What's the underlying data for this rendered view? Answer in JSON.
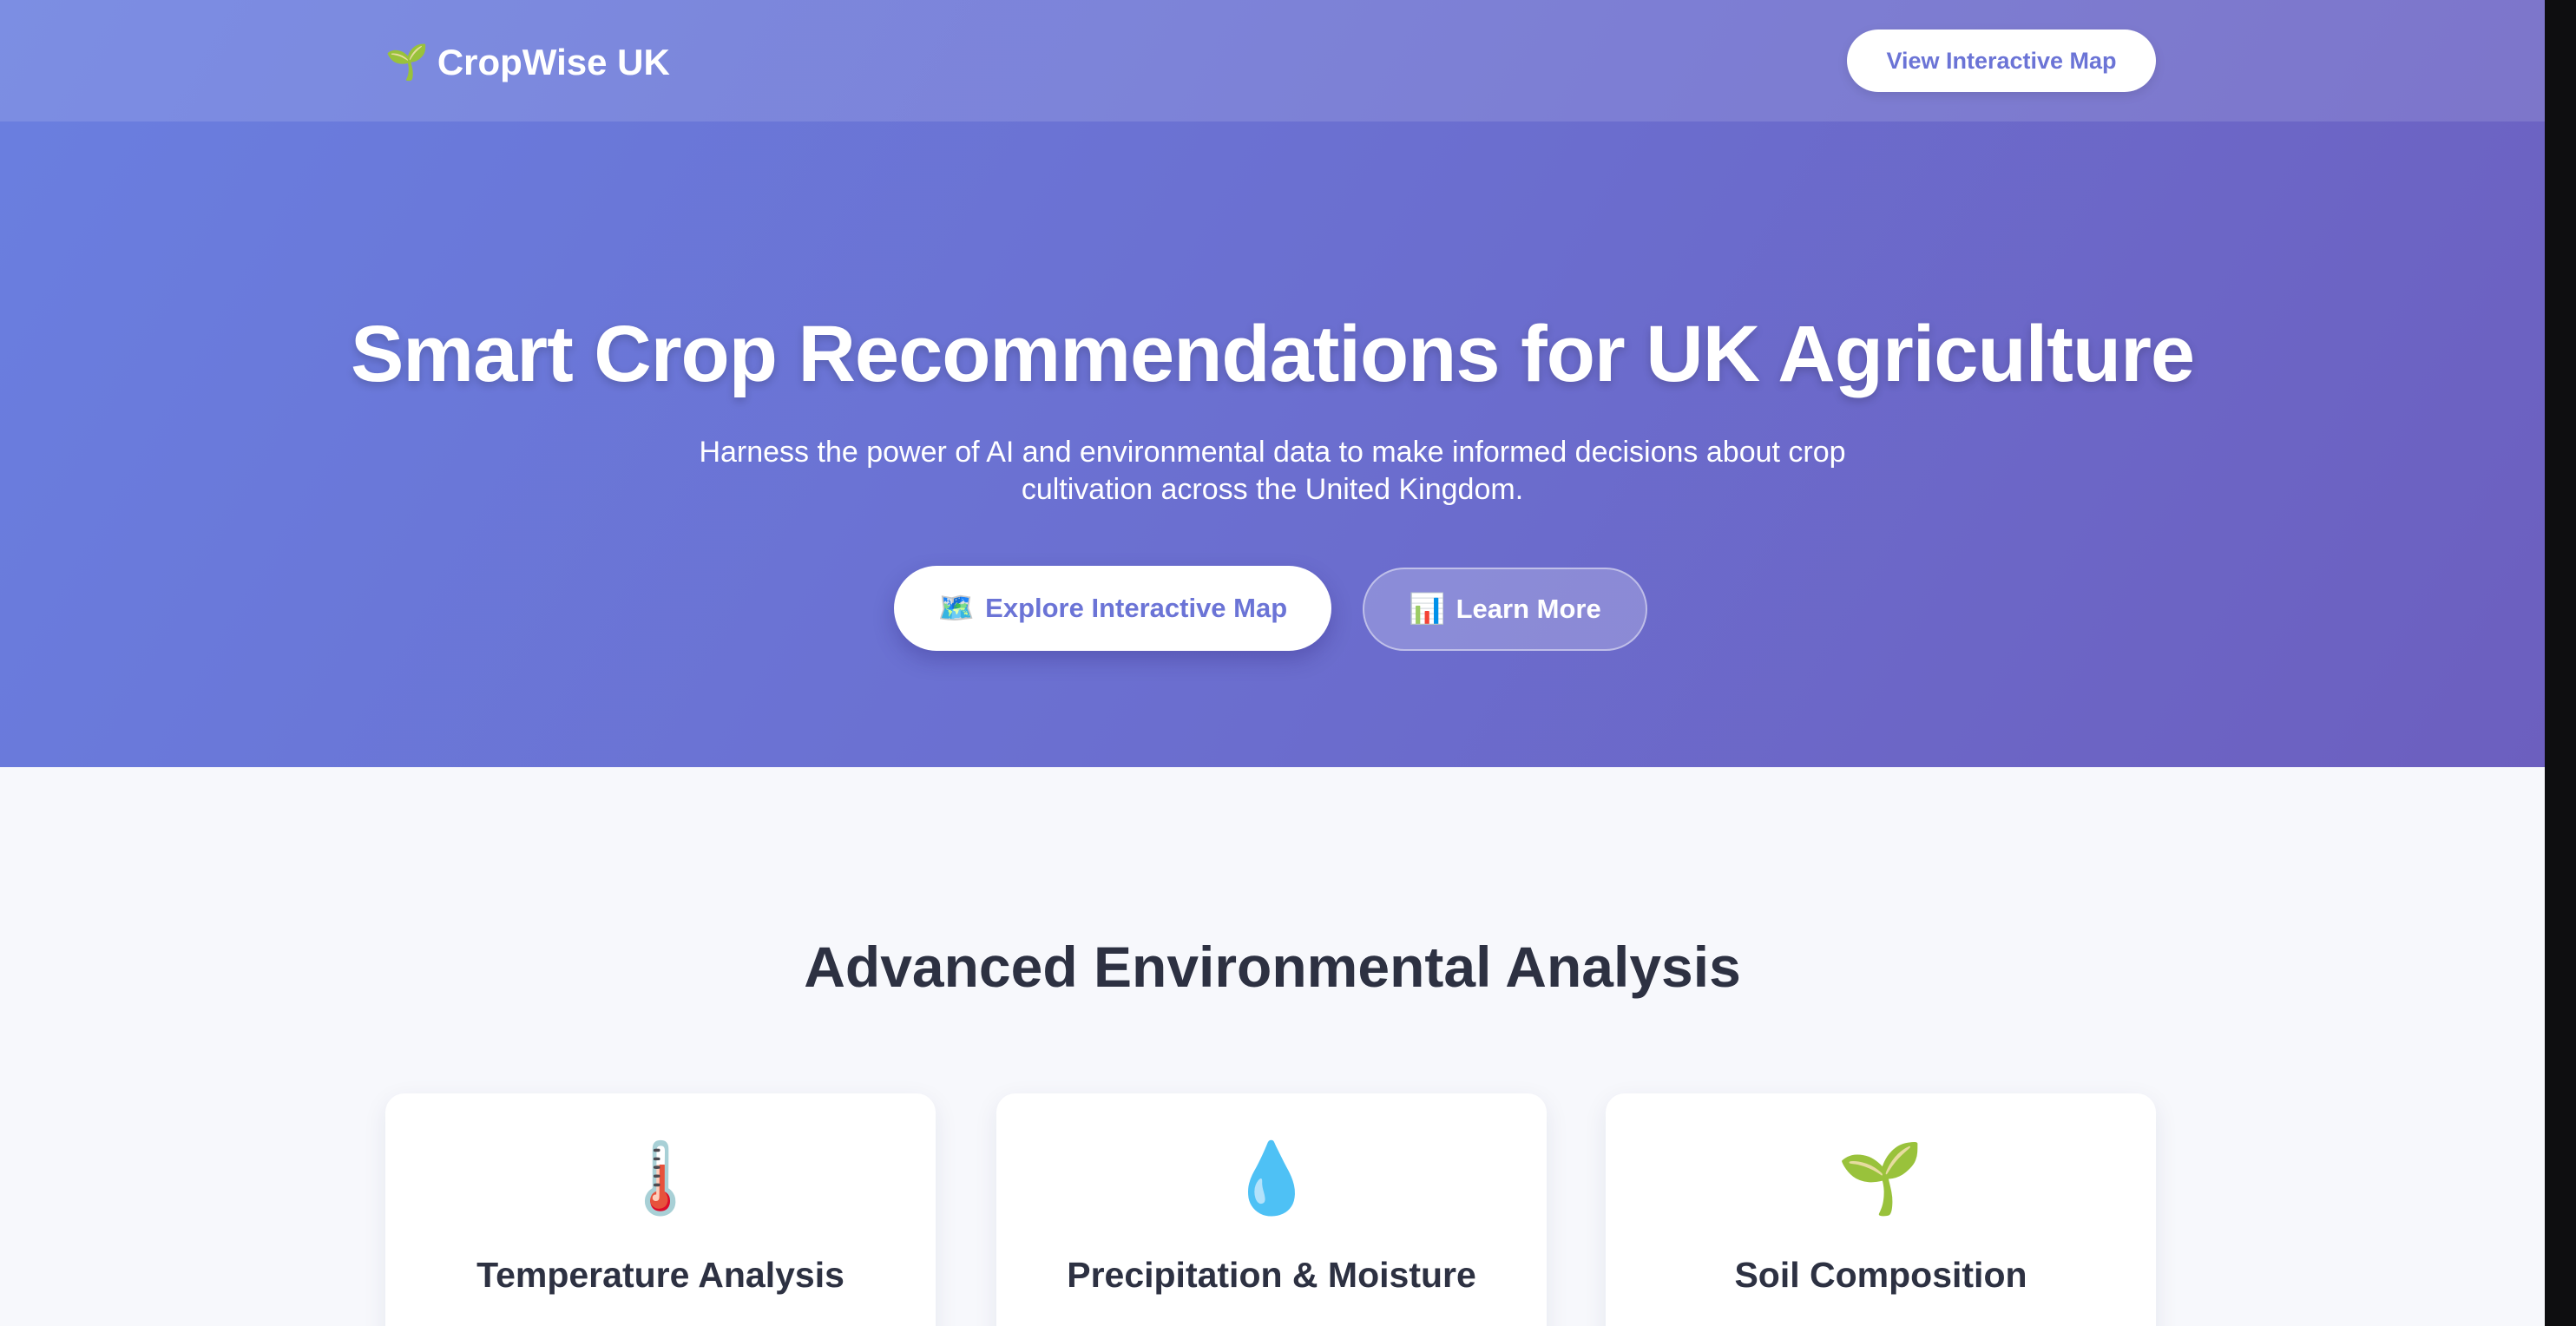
{
  "nav": {
    "brand_icon": "seedling-icon",
    "brand_emoji": "🌱",
    "brand_name": "CropWise UK",
    "map_button_label": "View Interactive Map"
  },
  "hero": {
    "title": "Smart Crop Recommendations for UK Agriculture",
    "subtitle": "Harness the power of AI and environmental data to make informed decisions about crop cultivation across the United Kingdom.",
    "primary_button": {
      "icon": "map-icon",
      "emoji": "🗺️",
      "label": "Explore Interactive Map"
    },
    "secondary_button": {
      "icon": "bar-chart-icon",
      "emoji": "📊",
      "label": "Learn More"
    }
  },
  "features": {
    "title": "Advanced Environmental Analysis",
    "cards": [
      {
        "icon": "thermometer-icon",
        "emoji": "🌡️",
        "title": "Temperature Analysis"
      },
      {
        "icon": "droplet-icon",
        "emoji": "💧",
        "title": "Precipitation & Moisture"
      },
      {
        "icon": "seedling-icon",
        "emoji": "🌱",
        "title": "Soil Composition"
      }
    ]
  },
  "colors": {
    "hero_gradient_start": "#6a7fe0",
    "hero_gradient_end": "#6c5fbf",
    "accent_text": "#6b74d6",
    "heading_text": "#2d3142",
    "page_background": "#f7f8fc"
  }
}
